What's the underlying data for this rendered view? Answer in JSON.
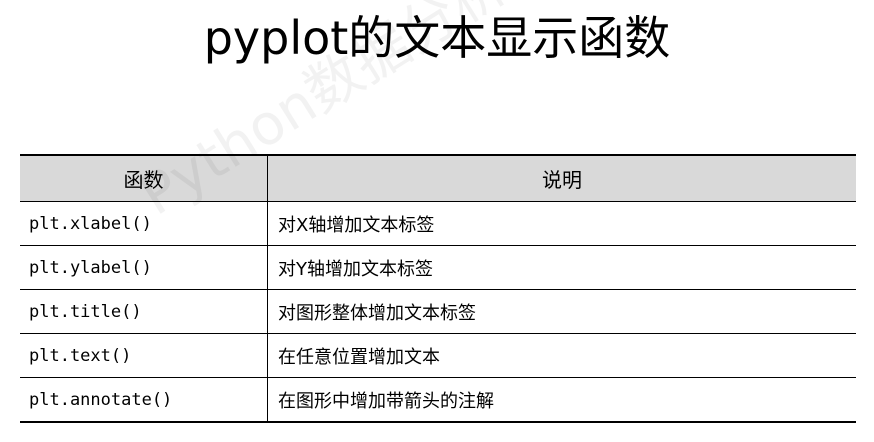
{
  "title": "pyplot的文本显示函数",
  "watermark": "Python数据分析与展示",
  "table": {
    "headers": [
      "函数",
      "说明"
    ],
    "rows": [
      {
        "func": "plt.xlabel()",
        "desc": "对X轴增加文本标签"
      },
      {
        "func": "plt.ylabel()",
        "desc": "对Y轴增加文本标签"
      },
      {
        "func": "plt.title()",
        "desc": "对图形整体增加文本标签"
      },
      {
        "func": "plt.text()",
        "desc": "在任意位置增加文本"
      },
      {
        "func": "plt.annotate()",
        "desc": "在图形中增加带箭头的注解"
      }
    ]
  }
}
